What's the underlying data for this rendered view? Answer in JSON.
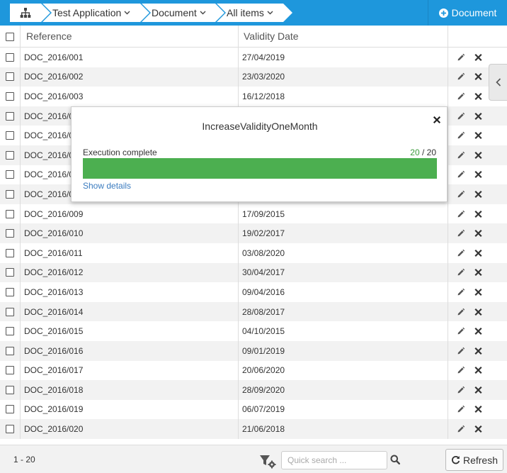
{
  "breadcrumb": {
    "items": [
      {
        "label": "Test Application"
      },
      {
        "label": "Document"
      },
      {
        "label": "All items"
      }
    ]
  },
  "toolbar": {
    "new_document_label": "Document"
  },
  "table": {
    "columns": {
      "reference": "Reference",
      "validity_date": "Validity Date"
    },
    "rows": [
      {
        "reference": "DOC_2016/001",
        "validity_date": "27/04/2019"
      },
      {
        "reference": "DOC_2016/002",
        "validity_date": "23/03/2020"
      },
      {
        "reference": "DOC_2016/003",
        "validity_date": "16/12/2018"
      },
      {
        "reference": "DOC_2016/0",
        "validity_date": ""
      },
      {
        "reference": "DOC_2016/0",
        "validity_date": ""
      },
      {
        "reference": "DOC_2016/0",
        "validity_date": ""
      },
      {
        "reference": "DOC_2016/0",
        "validity_date": ""
      },
      {
        "reference": "DOC_2016/0",
        "validity_date": ""
      },
      {
        "reference": "DOC_2016/009",
        "validity_date": "17/09/2015"
      },
      {
        "reference": "DOC_2016/010",
        "validity_date": "19/02/2017"
      },
      {
        "reference": "DOC_2016/011",
        "validity_date": "03/08/2020"
      },
      {
        "reference": "DOC_2016/012",
        "validity_date": "30/04/2017"
      },
      {
        "reference": "DOC_2016/013",
        "validity_date": "09/04/2016"
      },
      {
        "reference": "DOC_2016/014",
        "validity_date": "28/08/2017"
      },
      {
        "reference": "DOC_2016/015",
        "validity_date": "04/10/2015"
      },
      {
        "reference": "DOC_2016/016",
        "validity_date": "09/01/2019"
      },
      {
        "reference": "DOC_2016/017",
        "validity_date": "20/06/2020"
      },
      {
        "reference": "DOC_2016/018",
        "validity_date": "28/09/2020"
      },
      {
        "reference": "DOC_2016/019",
        "validity_date": "06/07/2019"
      },
      {
        "reference": "DOC_2016/020",
        "validity_date": "21/06/2018"
      }
    ]
  },
  "popup": {
    "title": "IncreaseValidityOneMonth",
    "status": "Execution complete",
    "done": "20",
    "separator": " / ",
    "total": "20",
    "progress_fraction": 1.0,
    "details_link": "Show details"
  },
  "footer": {
    "range": "1 - 20",
    "search_placeholder": "Quick search ...",
    "refresh_label": "Refresh"
  },
  "colors": {
    "topbar": "#1e97dc",
    "progress": "#4caf50",
    "link": "#3a7bbf"
  }
}
